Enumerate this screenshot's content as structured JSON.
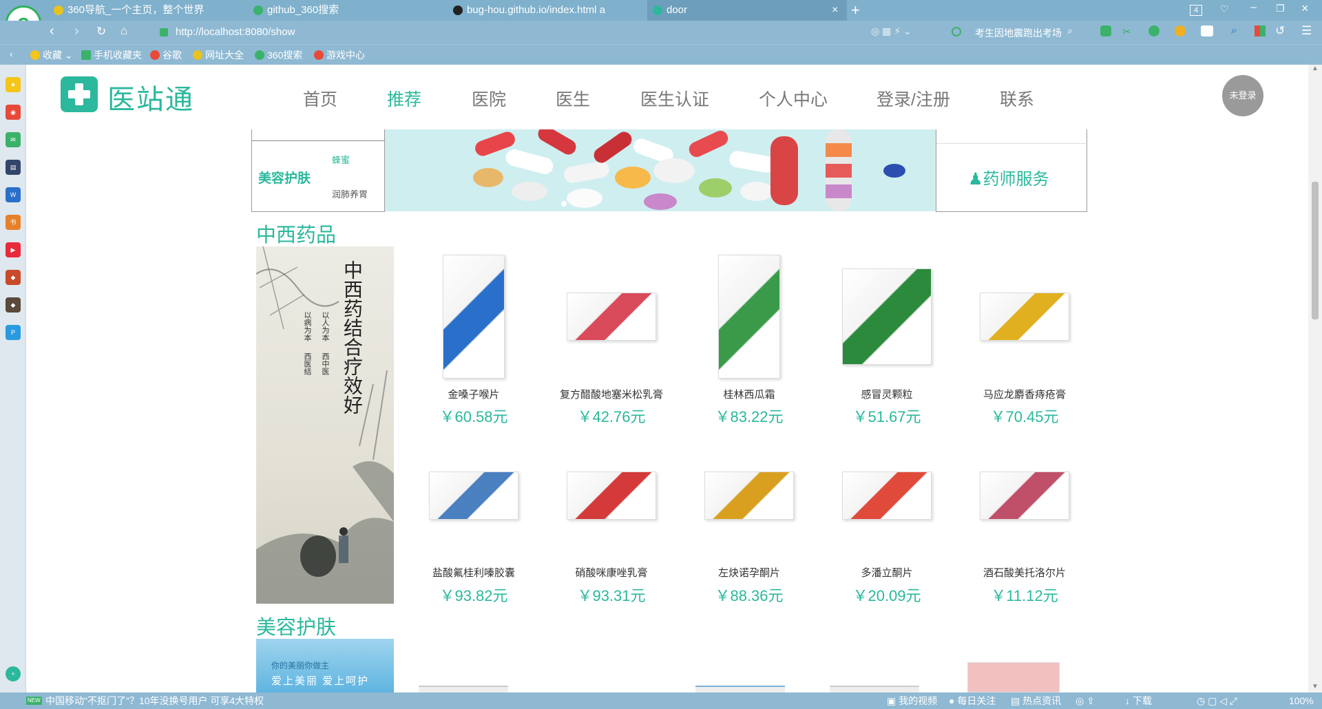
{
  "browser": {
    "tabs": [
      {
        "title": "360导航_一个主页，整个世界"
      },
      {
        "title": "github_360搜索"
      },
      {
        "title": "bug-hou.github.io/index.html a"
      },
      {
        "title": "door"
      }
    ],
    "tab_count": "4",
    "url": "http://localhost:8080/show",
    "search_text": "考生因地震跑出考场",
    "bookmarks": [
      "收藏",
      "手机收藏夹",
      "谷歌",
      "网址大全",
      "360搜索",
      "游戏中心"
    ],
    "status_news": "中国移动\"不抠门了\"？10年没换号用户 可享4大特权",
    "status_items": [
      "我的视频",
      "每日关注",
      "热点资讯",
      "下载"
    ],
    "zoom": "100%"
  },
  "site": {
    "logo_text": "医站通",
    "nav": [
      "首页",
      "推荐",
      "医院",
      "医生",
      "医生认证",
      "个人中心",
      "登录/注册",
      "联系"
    ],
    "login_badge": "未登录"
  },
  "banner": {
    "category": "美容护肤",
    "sub_top": "蜂蜜",
    "sub_bottom": "润肺养胃",
    "service": "药师服务"
  },
  "sections": [
    {
      "title": "中西药品",
      "poster_text": "中西药结合疗效好",
      "poster_sub": [
        "以人为本",
        "以病为本",
        "西中医",
        "西医结"
      ],
      "products": [
        {
          "name": "金嗓子喉片",
          "price": "￥60.58元",
          "color": "#2a6fc9"
        },
        {
          "name": "复方醋酸地塞米松乳膏",
          "price": "￥42.76元",
          "color": "#d94a5a"
        },
        {
          "name": "桂林西瓜霜",
          "price": "￥83.22元",
          "color": "#3a9a4a"
        },
        {
          "name": "感冒灵颗粒",
          "price": "￥51.67元",
          "color": "#2c8a3c"
        },
        {
          "name": "马应龙麝香痔疮膏",
          "price": "￥70.45元",
          "color": "#e0b020"
        },
        {
          "name": "盐酸氟桂利嗪胶囊",
          "price": "￥93.82元",
          "color": "#4a7fc0"
        },
        {
          "name": "硝酸咪康唑乳膏",
          "price": "￥93.31元",
          "color": "#d43a3a"
        },
        {
          "name": "左炔诺孕酮片",
          "price": "￥88.36元",
          "color": "#d9a020"
        },
        {
          "name": "多潘立酮片",
          "price": "￥20.09元",
          "color": "#e04a3a"
        },
        {
          "name": "酒石酸美托洛尔片",
          "price": "￥11.12元",
          "color": "#c0506a"
        }
      ]
    },
    {
      "title": "美容护肤",
      "poster_text": "你的美丽你做主",
      "poster_sub2": "爱上美丽 爱上呵护"
    }
  ]
}
